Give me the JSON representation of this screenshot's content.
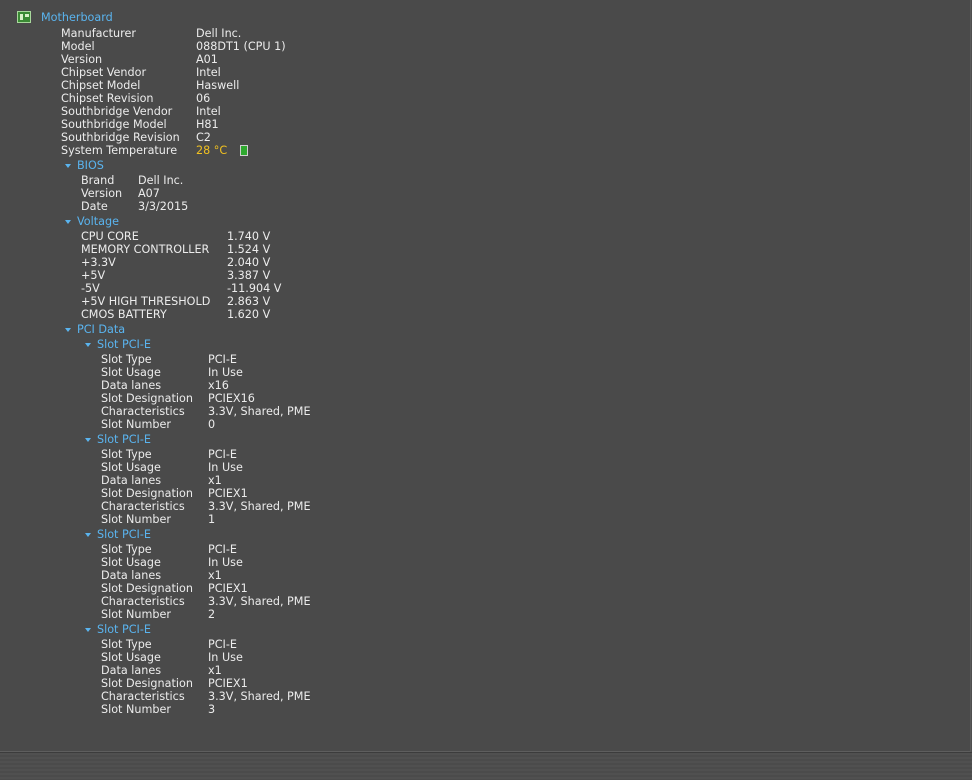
{
  "motherboard": {
    "title": "Motherboard",
    "icon": "motherboard-icon",
    "properties": [
      {
        "label": "Manufacturer",
        "value": "Dell Inc."
      },
      {
        "label": "Model",
        "value": "088DT1 (CPU 1)"
      },
      {
        "label": "Version",
        "value": "A01"
      },
      {
        "label": "Chipset Vendor",
        "value": "Intel"
      },
      {
        "label": "Chipset Model",
        "value": "Haswell"
      },
      {
        "label": "Chipset Revision",
        "value": "06"
      },
      {
        "label": "Southbridge Vendor",
        "value": "Intel"
      },
      {
        "label": "Southbridge Model",
        "value": "H81"
      },
      {
        "label": "Southbridge Revision",
        "value": "C2"
      }
    ],
    "system_temperature": {
      "label": "System Temperature",
      "value": "28 °C",
      "color": "#f0c020",
      "icon": "temperature-status-icon",
      "status_color": "#2ea82e"
    }
  },
  "bios": {
    "title": "BIOS",
    "properties": [
      {
        "label": "Brand",
        "value": "Dell Inc."
      },
      {
        "label": "Version",
        "value": "A07"
      },
      {
        "label": "Date",
        "value": "3/3/2015"
      }
    ]
  },
  "voltage": {
    "title": "Voltage",
    "properties": [
      {
        "label": "CPU CORE",
        "value": "1.740 V"
      },
      {
        "label": "MEMORY CONTROLLER",
        "value": "1.524 V"
      },
      {
        "label": "+3.3V",
        "value": "2.040 V"
      },
      {
        "label": "+5V",
        "value": "3.387 V"
      },
      {
        "label": "-5V",
        "value": "-11.904 V"
      },
      {
        "label": "+5V HIGH THRESHOLD",
        "value": "2.863 V"
      },
      {
        "label": "CMOS BATTERY",
        "value": "1.620 V"
      }
    ]
  },
  "pci": {
    "title": "PCI Data",
    "slots": [
      {
        "title": "Slot PCI-E",
        "properties": [
          {
            "label": "Slot Type",
            "value": "PCI-E"
          },
          {
            "label": "Slot Usage",
            "value": "In Use"
          },
          {
            "label": "Data lanes",
            "value": "x16"
          },
          {
            "label": "Slot Designation",
            "value": "PCIEX16"
          },
          {
            "label": "Characteristics",
            "value": "3.3V, Shared, PME"
          },
          {
            "label": "Slot Number",
            "value": "0"
          }
        ]
      },
      {
        "title": "Slot PCI-E",
        "properties": [
          {
            "label": "Slot Type",
            "value": "PCI-E"
          },
          {
            "label": "Slot Usage",
            "value": "In Use"
          },
          {
            "label": "Data lanes",
            "value": "x1"
          },
          {
            "label": "Slot Designation",
            "value": "PCIEX1"
          },
          {
            "label": "Characteristics",
            "value": "3.3V, Shared, PME"
          },
          {
            "label": "Slot Number",
            "value": "1"
          }
        ]
      },
      {
        "title": "Slot PCI-E",
        "properties": [
          {
            "label": "Slot Type",
            "value": "PCI-E"
          },
          {
            "label": "Slot Usage",
            "value": "In Use"
          },
          {
            "label": "Data lanes",
            "value": "x1"
          },
          {
            "label": "Slot Designation",
            "value": "PCIEX1"
          },
          {
            "label": "Characteristics",
            "value": "3.3V, Shared, PME"
          },
          {
            "label": "Slot Number",
            "value": "2"
          }
        ]
      },
      {
        "title": "Slot PCI-E",
        "properties": [
          {
            "label": "Slot Type",
            "value": "PCI-E"
          },
          {
            "label": "Slot Usage",
            "value": "In Use"
          },
          {
            "label": "Data lanes",
            "value": "x1"
          },
          {
            "label": "Slot Designation",
            "value": "PCIEX1"
          },
          {
            "label": "Characteristics",
            "value": "3.3V, Shared, PME"
          },
          {
            "label": "Slot Number",
            "value": "3"
          }
        ]
      }
    ]
  }
}
